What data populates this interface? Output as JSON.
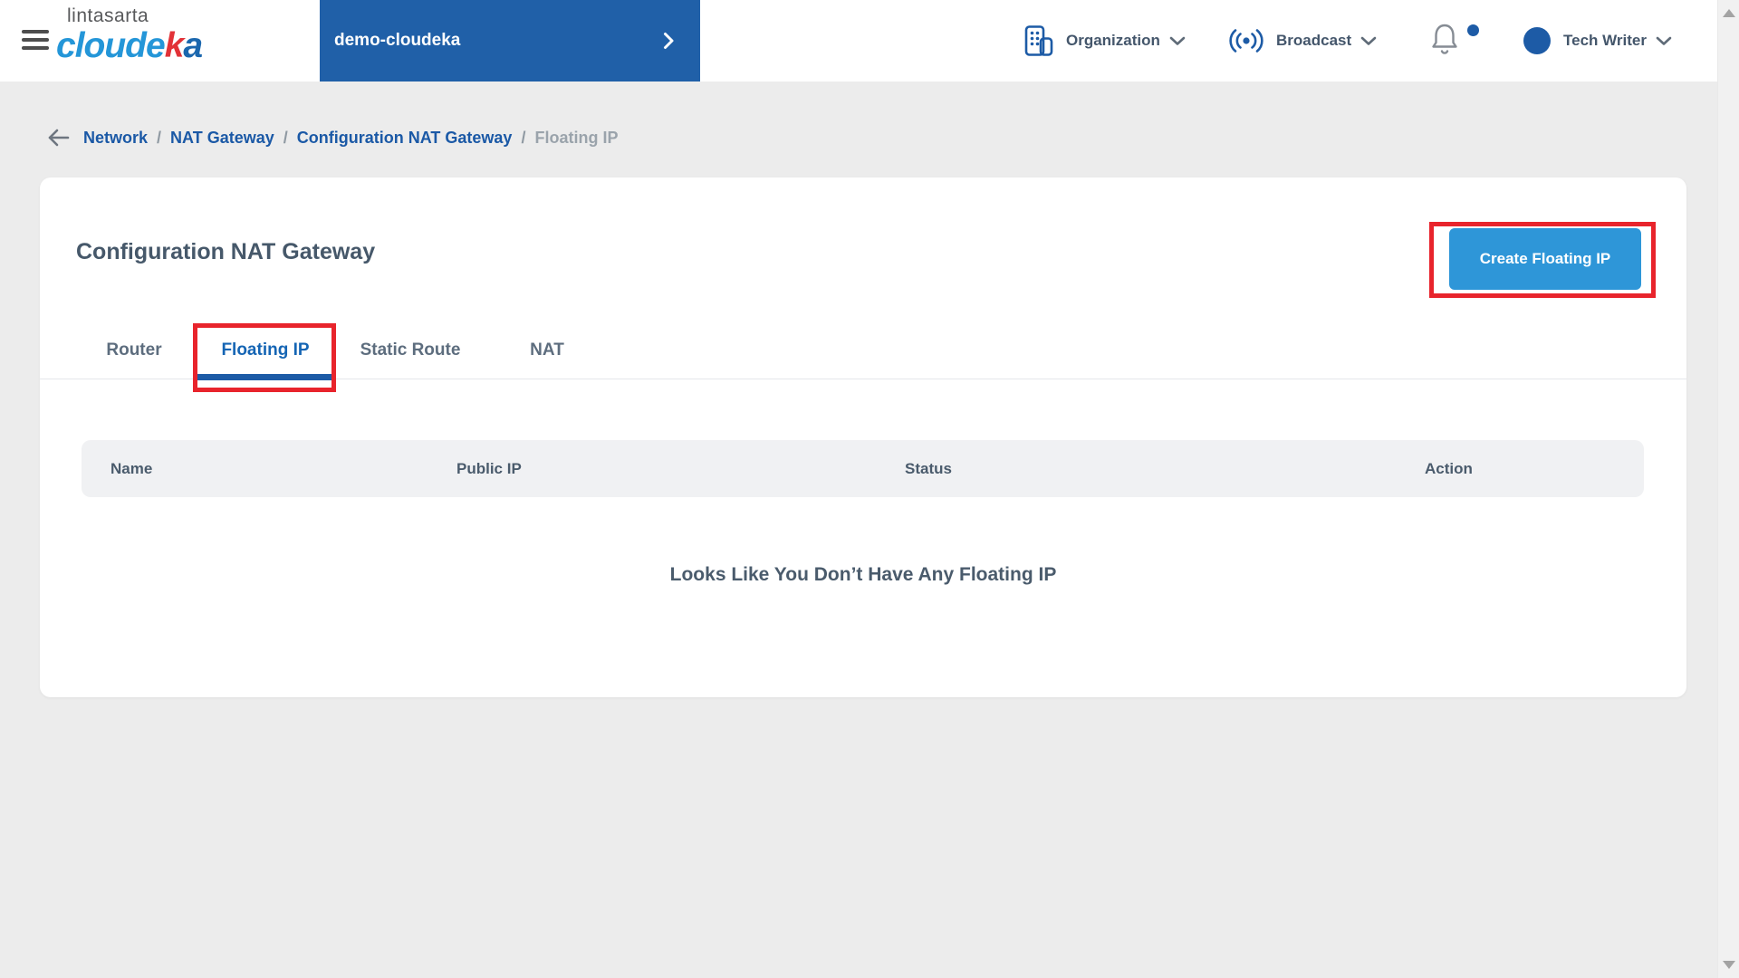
{
  "header": {
    "company_logo": "lintasarta",
    "product_logo": {
      "part1": "cloude",
      "accent": "k",
      "part2": "a"
    },
    "project": {
      "name": "demo-cloudeka"
    },
    "menus": {
      "organization": "Organization",
      "broadcast": "Broadcast",
      "user": "Tech Writer"
    },
    "notifications": {
      "has_unread": true
    }
  },
  "breadcrumb": {
    "separator": "/",
    "items": [
      {
        "label": "Network"
      },
      {
        "label": "NAT Gateway"
      },
      {
        "label": "Configuration NAT Gateway"
      },
      {
        "label": "Floating IP"
      }
    ]
  },
  "main": {
    "title": "Configuration NAT Gateway",
    "create_button_label": "Create Floating IP",
    "tabs": [
      {
        "label": "Router",
        "active": false
      },
      {
        "label": "Floating IP",
        "active": true
      },
      {
        "label": "Static Route",
        "active": false
      },
      {
        "label": "NAT",
        "active": false
      }
    ],
    "table": {
      "columns": [
        "Name",
        "Public IP",
        "Status",
        "Action"
      ],
      "rows": []
    },
    "empty_message": "Looks Like You Don’t Have Any Floating IP"
  },
  "annotations": {
    "highlight_color": "#e8242c",
    "highlighted_elements": [
      "create-floating-ip-button",
      "tab-floating-ip"
    ]
  },
  "icons": {
    "hamburger": "menu-icon",
    "organization": "building-icon",
    "broadcast": "radio-waves-icon",
    "notification": "bell-icon",
    "back": "arrow-left-icon",
    "dropdown": "chevron-down-icon",
    "project_expand": "chevron-right-icon"
  },
  "colors": {
    "project_panel_bg": "#2060a8",
    "accent_blue": "#1d5ba6",
    "button_blue": "#2e96d8",
    "active_tab_blue": "#1565b4",
    "breadcrumb_link": "#1b59a6",
    "text_primary": "#46586a",
    "text_secondary": "#5d6d7e",
    "page_bg": "#ececec",
    "table_header_bg": "#f0f1f3",
    "annotation_red": "#e8242c"
  }
}
